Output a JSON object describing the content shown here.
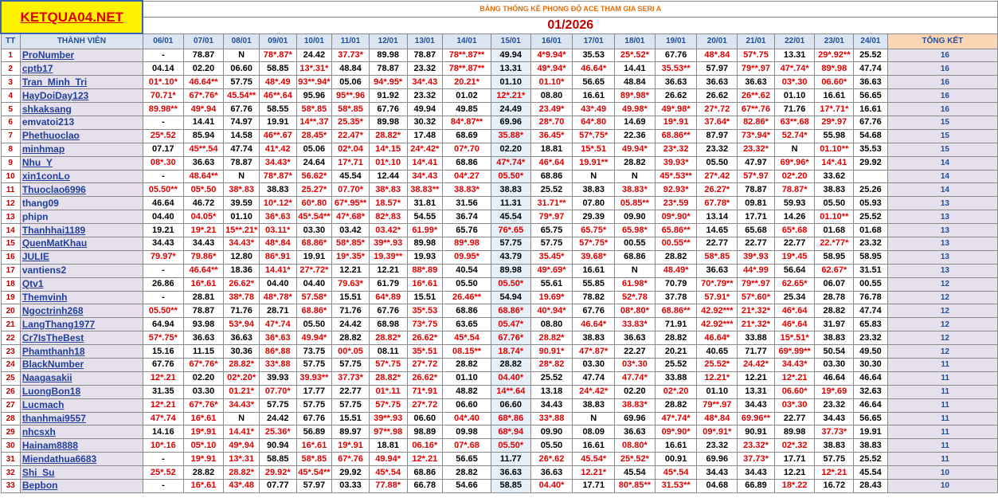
{
  "logo": "KETQUA04.NET",
  "title": "BẢNG THỐNG KÊ PHONG ĐỘ ACE THAM GIA SERI A",
  "month": "01/2026",
  "headers": {
    "tt": "TT",
    "member": "THÀNH VIÊN",
    "total": "TỔNG KẾT"
  },
  "dates": [
    "06/01",
    "07/01",
    "08/01",
    "09/01",
    "10/01",
    "11/01",
    "12/01",
    "13/01",
    "14/01",
    "15/01",
    "16/01",
    "17/01",
    "18/01",
    "19/01",
    "20/01",
    "21/01",
    "22/01",
    "23/01",
    "24/01"
  ],
  "rows": [
    {
      "tt": "1",
      "name": "ProNumber",
      "total": "16",
      "cells": [
        "-",
        "78.87",
        "N",
        "78*.87*",
        "24.42",
        "37.73*",
        "89.98",
        "78.87",
        "78**.87**",
        "49.94",
        "4*9.94*",
        "35.53",
        "25*.52*",
        "67.76",
        "48*.84",
        "57*.75",
        "13.31",
        "29*.92**",
        "25.52"
      ]
    },
    {
      "tt": "2",
      "name": "cptb17",
      "total": "16",
      "cells": [
        "04.14",
        "02.20",
        "06.60",
        "58.85",
        "13*.31*",
        "48.84",
        "78.87",
        "23.32",
        "78**.87**",
        "13.31",
        "49*.94*",
        "46.64*",
        "14.41",
        "35.53**",
        "57.97",
        "79**.97",
        "47*.74*",
        "89*.98",
        "47.74"
      ]
    },
    {
      "tt": "3",
      "name": "Tran_Minh_Tri",
      "total": "16",
      "cells": [
        "01*.10*",
        "46.64**",
        "57.75",
        "48*.49",
        "93**.94*",
        "05.06",
        "94*.95*",
        "34*.43",
        "20.21*",
        "01.10",
        "01.10*",
        "56.65",
        "48.84",
        "36.63",
        "36.63",
        "36.63",
        "03*.30",
        "06.60*",
        "36.63"
      ]
    },
    {
      "tt": "4",
      "name": "HayDoiDay123",
      "total": "16",
      "cells": [
        "70.71*",
        "67*.76*",
        "45.54**",
        "46**.64",
        "95.96",
        "95**.96",
        "91.92",
        "23.32",
        "01.02",
        "12*.21*",
        "08.80",
        "16.61",
        "89*.98*",
        "26.62",
        "26.62",
        "26**.62",
        "01.10",
        "16.61",
        "56.65"
      ]
    },
    {
      "tt": "5",
      "name": "shkaksang",
      "total": "16",
      "cells": [
        "89.98**",
        "49*.94",
        "67.76",
        "58.55",
        "58*.85",
        "58*.85",
        "67.76",
        "49.94",
        "49.85",
        "24.49",
        "23.49*",
        "43*.49",
        "49.98*",
        "49*.98*",
        "27*.72",
        "67**.76",
        "71.76",
        "17*.71*",
        "16.61"
      ]
    },
    {
      "tt": "6",
      "name": "emvatoi213",
      "total": "15",
      "cells": [
        "-",
        "14.41",
        "74.97",
        "19.91",
        "14**.37",
        "25.35*",
        "89.98",
        "30.32",
        "84*.87**",
        "69.96",
        "28*.70",
        "64*.80",
        "14.69",
        "19*.91",
        "37.64*",
        "82.86*",
        "63**.68",
        "29*.97",
        "67.76"
      ]
    },
    {
      "tt": "7",
      "name": "Phethuoclao",
      "total": "15",
      "cells": [
        "25*.52",
        "85.94",
        "14.58",
        "46**.67",
        "28.45*",
        "22.47*",
        "28.82*",
        "17.48",
        "68.69",
        "35.88*",
        "36.45*",
        "57*.75*",
        "22.36",
        "68.86**",
        "87.97",
        "73*.94*",
        "52.74*",
        "55.98",
        "54.68"
      ]
    },
    {
      "tt": "8",
      "name": "minhmap",
      "total": "15",
      "cells": [
        "07.17",
        "45**.54",
        "47.74",
        "41*.42",
        "05.06",
        "02*.04",
        "14*.15",
        "24*.42*",
        "07*.70",
        "02.20",
        "18.81",
        "15*.51",
        "49.94*",
        "23*.32",
        "23.32",
        "23.32*",
        "N",
        "01.10**",
        "35.53"
      ]
    },
    {
      "tt": "9",
      "name": "Nhu_Y",
      "total": "14",
      "cells": [
        "08*.30",
        "36.63",
        "78.87",
        "34.43*",
        "24.64",
        "17*.71",
        "01*.10",
        "14*.41",
        "68.86",
        "47*.74*",
        "46*.64",
        "19.91**",
        "28.82",
        "39.93*",
        "05.50",
        "47.97",
        "69*.96*",
        "14*.41",
        "29.92"
      ]
    },
    {
      "tt": "10",
      "name": "xin1conLo",
      "total": "14",
      "cells": [
        "-",
        "48.64**",
        "N",
        "78*.87*",
        "56.62*",
        "45.54",
        "12.44",
        "34*.43",
        "04*.27",
        "05.50*",
        "68.86",
        "N",
        "N",
        "45*.53**",
        "27*.42",
        "57*.97",
        "02*.20",
        "33.62",
        ""
      ]
    },
    {
      "tt": "11",
      "name": "Thuoclao6996",
      "total": "14",
      "cells": [
        "05.50**",
        "05*.50",
        "38*.83",
        "38.83",
        "25.27*",
        "07.70*",
        "38*.83",
        "38.83**",
        "38.83*",
        "38.83",
        "25.52",
        "38.83",
        "38.83*",
        "92.93*",
        "26.27*",
        "78.87",
        "78.87*",
        "38.83",
        "25.26"
      ]
    },
    {
      "tt": "12",
      "name": "thang09",
      "total": "13",
      "cells": [
        "46.64",
        "46.72",
        "39.59",
        "10*.12*",
        "60*.80",
        "67*.95**",
        "18.57*",
        "31.81",
        "31.56",
        "11.31",
        "31.71**",
        "07.80",
        "05.85**",
        "23*.59",
        "67.78*",
        "09.81",
        "59.93",
        "05.50",
        "05.93"
      ]
    },
    {
      "tt": "13",
      "name": "phipn",
      "total": "13",
      "cells": [
        "04.40",
        "04.05*",
        "01.10",
        "36*.63",
        "45*.54**",
        "47*.68*",
        "82*.83",
        "54.55",
        "36.74",
        "45.54",
        "79*.97",
        "29.39",
        "09.90",
        "09*.90*",
        "13.14",
        "17.71",
        "14.26",
        "01.10**",
        "25.52"
      ]
    },
    {
      "tt": "14",
      "name": "Thanhhai1189",
      "total": "13",
      "cells": [
        "19.21",
        "19*.21",
        "15**.21*",
        "03.11*",
        "03.30",
        "03.42",
        "03.42*",
        "61.99*",
        "65.76",
        "76*.65",
        "65.75",
        "65.75*",
        "65.98*",
        "65.86**",
        "14.65",
        "65.68",
        "65*.68",
        "01.68",
        "01.68"
      ]
    },
    {
      "tt": "15",
      "name": "QuenMatKhau",
      "total": "13",
      "cells": [
        "34.43",
        "34.43",
        "34.43*",
        "48*.84",
        "68.86*",
        "58*.85*",
        "39**.93",
        "89.98",
        "89*.98",
        "57.75",
        "57.75",
        "57*.75*",
        "00.55",
        "00.55**",
        "22.77",
        "22.77",
        "22.77",
        "22.*77*",
        "23.32"
      ]
    },
    {
      "tt": "16",
      "name": "JULIE",
      "total": "13",
      "cells": [
        "79.97*",
        "79.86*",
        "12.80",
        "86*.91",
        "19.91",
        "19*.35*",
        "19.39**",
        "19.93",
        "09.95*",
        "43.79",
        "35.45*",
        "39.68*",
        "68.86",
        "28.82",
        "58*.85",
        "39*.93",
        "19*.45",
        "58.95",
        "58.95"
      ]
    },
    {
      "tt": "17",
      "name": "vantiens2",
      "total": "13",
      "cells": [
        "-",
        "46.64**",
        "18.36",
        "14.41*",
        "27*.72*",
        "12.21",
        "12.21",
        "88*.89",
        "40.54",
        "89.98",
        "49*.69*",
        "16.61",
        "N",
        "48.49*",
        "36.63",
        "44*.99",
        "56.64",
        "62.67*",
        "31.51"
      ]
    },
    {
      "tt": "18",
      "name": "Qtv1",
      "total": "12",
      "cells": [
        "26.86",
        "16*.61",
        "26.62*",
        "04.40",
        "04.40",
        "79.63*",
        "61.79",
        "16*.61",
        "05.50",
        "05.50*",
        "55.61",
        "55.85",
        "61.98*",
        "70.79",
        "70*.79**",
        "79**.97",
        "62.65*",
        "06.07",
        "00.55"
      ]
    },
    {
      "tt": "19",
      "name": "Themvinh",
      "total": "12",
      "cells": [
        "-",
        "28.81",
        "38*.78",
        "48*.78*",
        "57.58*",
        "15.51",
        "64*.89",
        "15.51",
        "26.46**",
        "54.94",
        "19.69*",
        "78.82",
        "52*.78",
        "37.78",
        "57.91*",
        "57*.60*",
        "25.34",
        "28.78",
        "76.78"
      ]
    },
    {
      "tt": "20",
      "name": "Ngoctrinh268",
      "total": "12",
      "cells": [
        "05.50**",
        "78.87",
        "71.76",
        "28.71",
        "68.86*",
        "71.76",
        "67.76",
        "35*.53",
        "68.86",
        "68.86*",
        "40*.94*",
        "67.76",
        "08*.80*",
        "68.86**",
        "42.92***",
        "21*.32*",
        "46*.64",
        "28.82",
        "47.74"
      ]
    },
    {
      "tt": "21",
      "name": "LangThang1977",
      "total": "12",
      "cells": [
        "64.94",
        "93.98",
        "53*.94",
        "47*.74",
        "05.50",
        "24.42",
        "68.98",
        "73*.75",
        "63.65",
        "05.47*",
        "08.80",
        "46.64*",
        "33.83*",
        "71.91",
        "42.92***",
        "21*.32*",
        "46*.64",
        "31.97",
        "65.83"
      ]
    },
    {
      "tt": "22",
      "name": "Cr7IsTheBest",
      "total": "12",
      "cells": [
        "57*.75*",
        "36.63",
        "36.63",
        "36*.63",
        "49.94*",
        "28.82",
        "28.82*",
        "26.62*",
        "45*.54",
        "67.76*",
        "28.82*",
        "38.83",
        "36.63",
        "28.82",
        "46.64*",
        "33.88",
        "15*.51*",
        "38.83",
        "23.32"
      ]
    },
    {
      "tt": "23",
      "name": "Phamthanh18",
      "total": "12",
      "cells": [
        "15.16",
        "11.15",
        "30.36",
        "86*.88",
        "73.75",
        "00*.05",
        "08.11",
        "35*.51",
        "08.15**",
        "18.74*",
        "90.91*",
        "47*.87*",
        "22.27",
        "20.21",
        "40.65",
        "71.77",
        "69*.99**",
        "50.54",
        "49.50"
      ]
    },
    {
      "tt": "24",
      "name": "BlackNumber",
      "total": "11",
      "cells": [
        "67.76",
        "67*.76*",
        "28.82*",
        "33*.88",
        "57.75",
        "57.75",
        "57*.75",
        "27*.72",
        "28.82",
        "28.82",
        "28*.82",
        "03.30",
        "03*.30",
        "25.52",
        "25.52*",
        "24.42*",
        "34.43*",
        "03.30",
        "30.30"
      ]
    },
    {
      "tt": "25",
      "name": "Naagasakii",
      "total": "11",
      "cells": [
        "12*.21",
        "02.20",
        "02*.20*",
        "39.93",
        "39.93**",
        "37.73*",
        "28.82*",
        "26.62*",
        "01.10",
        "04.40*",
        "25.52",
        "47.74",
        "47.74*",
        "33.88",
        "12.21*",
        "12.21",
        "12*.21",
        "46.64",
        "46.64"
      ]
    },
    {
      "tt": "26",
      "name": "LuongBon18",
      "total": "11",
      "cells": [
        "31.35",
        "03.30",
        "01.21*",
        "07.70*",
        "17.77",
        "22.77",
        "01*.11",
        "71*.91",
        "48.82",
        "14**.64",
        "13.18",
        "24*.42*",
        "02.20",
        "02*.20",
        "01.10",
        "13.31",
        "06.60*",
        "19*.69",
        "32.63"
      ]
    },
    {
      "tt": "27",
      "name": "Lucmach",
      "total": "11",
      "cells": [
        "12*.21",
        "67*.76*",
        "34.43*",
        "57.75",
        "57.75",
        "57.75",
        "57*.75",
        "27*.72",
        "06.60",
        "06.60",
        "34.43",
        "38.83",
        "38.83*",
        "28.82",
        "79**.97",
        "34.43",
        "03*.30",
        "23.32",
        "46.64"
      ]
    },
    {
      "tt": "28",
      "name": "thanhmai9557",
      "total": "11",
      "cells": [
        "47*.74",
        "16*.61",
        "N",
        "24.42",
        "67.76",
        "15.51",
        "39**.93",
        "06.60",
        "04*.40",
        "68*.86",
        "33*.88",
        "N",
        "69.96",
        "47*.74*",
        "48*.84",
        "69.96**",
        "22.77",
        "34.43",
        "56.65"
      ]
    },
    {
      "tt": "29",
      "name": "nhcsxh",
      "total": "11",
      "cells": [
        "14.16",
        "19*.91",
        "14.41*",
        "25.36*",
        "56.89",
        "89.97",
        "97**.98",
        "98.89",
        "09.98",
        "68*.94",
        "09.90",
        "08.09",
        "36.63",
        "09*.90*",
        "09*.91*",
        "90.91",
        "89.98",
        "37.73*",
        "19.91"
      ]
    },
    {
      "tt": "30",
      "name": "Hainam8888",
      "total": "11",
      "cells": [
        "10*.16",
        "05*.10",
        "49*.94",
        "90.94",
        "16*.61",
        "19*.91",
        "18.81",
        "06.16*",
        "07*.68",
        "05.50*",
        "05.50",
        "16.61",
        "08.80*",
        "16.61",
        "23.32",
        "23.32*",
        "02*.32",
        "38.83",
        "38.83"
      ]
    },
    {
      "tt": "31",
      "name": "Miendathua6683",
      "total": "11",
      "cells": [
        "-",
        "19*.91",
        "13*.31",
        "58.85",
        "58*.85",
        "67*.76",
        "49.94*",
        "12*.21",
        "56.65",
        "11.77",
        "26*.62",
        "45.54*",
        "25*.52*",
        "00.91",
        "69.96",
        "37.73*",
        "17.71",
        "57.75",
        "25.52"
      ]
    },
    {
      "tt": "32",
      "name": "Shi_Su",
      "total": "10",
      "cells": [
        "25*.52",
        "28.82",
        "28.82*",
        "29.92*",
        "45*.54**",
        "29.92",
        "45*.54",
        "68.86",
        "28.82",
        "36.63",
        "36.63",
        "12.21*",
        "45.54",
        "45*.54",
        "34.43",
        "34.43",
        "12.21",
        "12*.21",
        "45.54"
      ]
    },
    {
      "tt": "33",
      "name": "Bepbon",
      "total": "10",
      "cells": [
        "-",
        "16*.61",
        "43*.48",
        "07.77",
        "57.97",
        "03.33",
        "77.88*",
        "66.78",
        "54.66",
        "58.85",
        "04.40*",
        "17.71",
        "80*.85**",
        "31.53**",
        "04.68",
        "66.89",
        "18*.22",
        "16.72",
        "28.43"
      ]
    }
  ]
}
